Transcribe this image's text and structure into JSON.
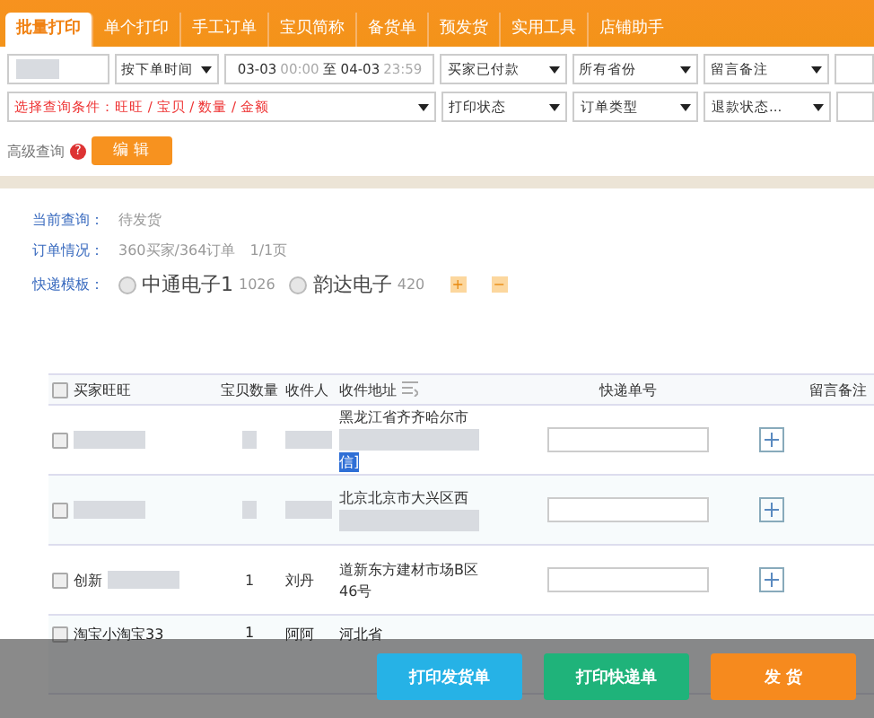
{
  "tabs": [
    {
      "label": "批量打印",
      "selected": true
    },
    {
      "label": "单个打印",
      "selected": false
    },
    {
      "label": "手工订单",
      "selected": false
    },
    {
      "label": "宝贝简称",
      "selected": false
    },
    {
      "label": "备货单",
      "selected": false
    },
    {
      "label": "预发货",
      "selected": false
    },
    {
      "label": "实用工具",
      "selected": false
    },
    {
      "label": "店铺助手",
      "selected": false
    }
  ],
  "filters": {
    "search_redacted": true,
    "time_type": "按下单时间",
    "date_range": {
      "start_date": "03-03",
      "start_time": "00:00",
      "separator": "至",
      "end_date": "04-03",
      "end_time": "23:59"
    },
    "row1_selects": [
      "买家已付款",
      "所有省份",
      "留言备注"
    ],
    "condition": "选择查询条件：旺旺 / 宝贝 / 数量 / 金额",
    "row2_selects": [
      "打印状态",
      "订单类型",
      "退款状态..."
    ]
  },
  "advanced": {
    "label": "高级查询",
    "help": "?",
    "button": "编 辑"
  },
  "info": {
    "query_label": "当前查询：",
    "query_value": "待发货",
    "orders_label": "订单情况：",
    "orders_value": "360买家/364订单",
    "pages": "1/1页",
    "template_label": "快递模板：",
    "templates": [
      {
        "name": "中通电子1",
        "count": "1026",
        "selected": false
      },
      {
        "name": "韵达电子",
        "count": "420",
        "selected": false
      }
    ],
    "add": "+",
    "remove": "−"
  },
  "table": {
    "all_checked": false,
    "columns": [
      "买家旺旺",
      "宝贝数量",
      "收件人",
      "收件地址",
      "快递单号",
      "留言备注"
    ],
    "rows": [
      {
        "checked": false,
        "buyer": "",
        "qty": "",
        "receiver": "",
        "address": [
          "黑龙江省齐齐哈尔市"
        ],
        "address_redacted": true,
        "highlight": "信]"
      },
      {
        "checked": false,
        "buyer": "",
        "qty": "",
        "receiver": "",
        "address": [
          "北京北京市大兴区西"
        ],
        "address_redacted": true
      },
      {
        "checked": false,
        "buyer": "创新",
        "qty": "1",
        "receiver": "刘丹",
        "address": [
          "道新东方建材市场B区",
          "46号"
        ]
      },
      {
        "checked": false,
        "buyer": "淘宝小淘宝33",
        "qty": "1",
        "receiver": "阿阿",
        "address": [
          "河北省"
        ]
      }
    ]
  },
  "actions": [
    {
      "label": "打印发货单",
      "kind": "blue"
    },
    {
      "label": "打印快递单",
      "kind": "green"
    },
    {
      "label": "发 货",
      "kind": "orange"
    }
  ]
}
